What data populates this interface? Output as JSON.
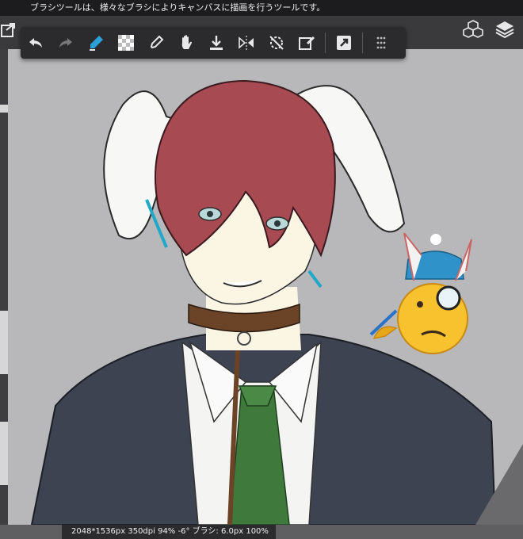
{
  "hint": {
    "text": "ブラシツールは、様々なブラシによりキャンバスに描画を行うツールです。"
  },
  "toolbar": {
    "items": [
      {
        "icon": "undo-icon"
      },
      {
        "icon": "redo-icon"
      },
      {
        "icon": "brush-eraser-swap-icon"
      },
      {
        "icon": "transparent-color-icon"
      },
      {
        "icon": "eyedropper-icon"
      },
      {
        "icon": "hand-icon"
      },
      {
        "icon": "import-icon"
      },
      {
        "icon": "flip-horizontal-icon"
      },
      {
        "icon": "rotate-reset-icon"
      },
      {
        "icon": "edit-layer-icon"
      },
      {
        "icon": "export-icon"
      },
      {
        "icon": "grid-menu-icon"
      }
    ]
  },
  "right_icons": [
    "cubes-icon",
    "layers-icon"
  ],
  "status": {
    "text": "2048*1536px 350dpi 94% -6° ブラシ: 6.0px 100%"
  },
  "colors": {
    "canvas_bg": "#b8b8ba",
    "toolbar_bg": "#2b2b2d",
    "hair": "#a84a52",
    "jacket": "#3d4350",
    "tie": "#3f7a3c",
    "collar": "#6b4326"
  }
}
